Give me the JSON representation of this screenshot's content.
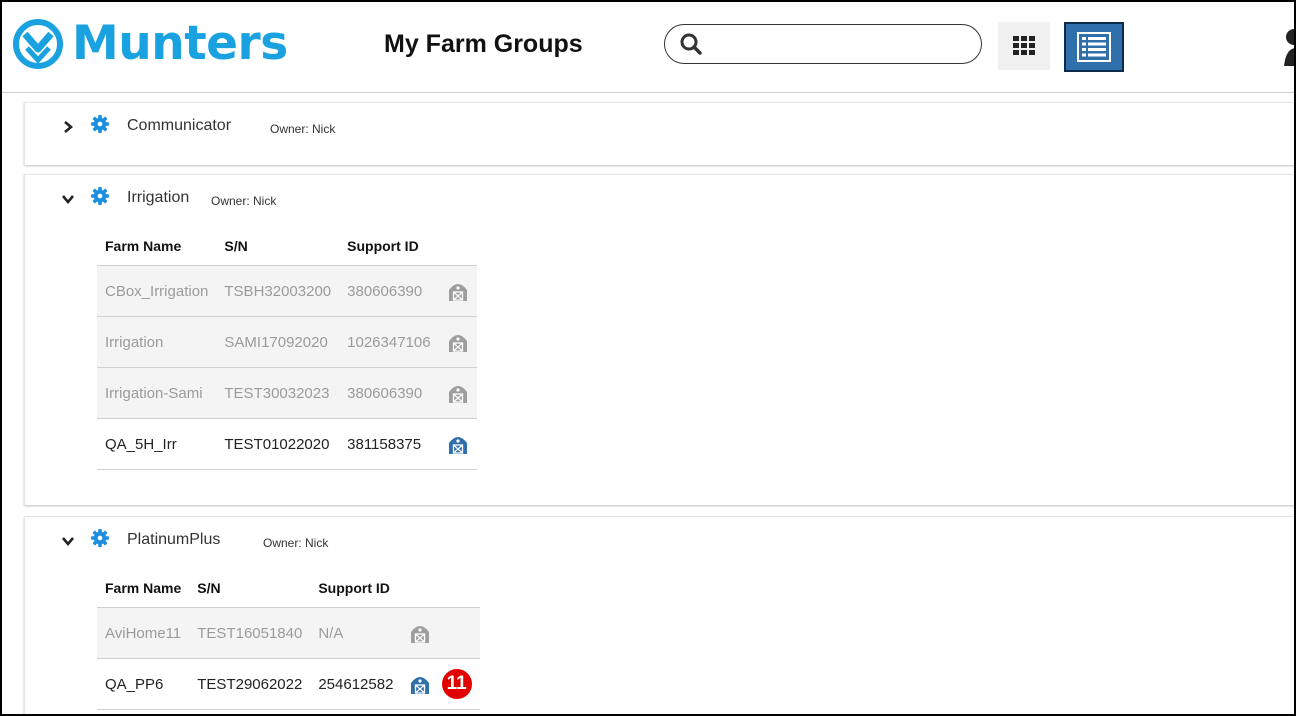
{
  "header": {
    "brand": "Munters",
    "title": "My Farm Groups",
    "search_placeholder": "",
    "brand_color": "#1aa2e0",
    "accent_color": "#2f6faa"
  },
  "groups": [
    {
      "name": "Communicator",
      "owner": "Owner: Nick",
      "expanded": false
    },
    {
      "name": "Irrigation",
      "owner": "Owner: Nick",
      "expanded": true,
      "columns": [
        "Farm Name",
        "S/N",
        "Support ID"
      ],
      "rows": [
        {
          "farm": "CBox_Irrigation",
          "sn": "TSBH32003200",
          "support_id": "380606390",
          "status": "inactive"
        },
        {
          "farm": "Irrigation",
          "sn": "SAMI17092020",
          "support_id": "1026347106",
          "status": "inactive"
        },
        {
          "farm": "Irrigation-Sami",
          "sn": "TEST30032023",
          "support_id": "380606390",
          "status": "inactive"
        },
        {
          "farm": "QA_5H_Irr",
          "sn": "TEST01022020",
          "support_id": "381158375",
          "status": "active"
        }
      ]
    },
    {
      "name": "PlatinumPlus",
      "owner": "Owner: Nick",
      "expanded": true,
      "columns": [
        "Farm Name",
        "S/N",
        "Support ID"
      ],
      "rows": [
        {
          "farm": "AviHome11",
          "sn": "TEST16051840",
          "support_id": "N/A",
          "status": "inactive"
        },
        {
          "farm": "QA_PP6",
          "sn": "TEST29062022",
          "support_id": "254612582",
          "status": "active",
          "badge": "11"
        }
      ]
    }
  ],
  "icons": {
    "search": "search-icon",
    "grid_view": "grid-view-icon",
    "list_view": "list-view-icon",
    "gear": "gear-icon",
    "barn": "barn-icon",
    "chevron_right": "chevron-right-icon",
    "chevron_down": "chevron-down-icon"
  }
}
